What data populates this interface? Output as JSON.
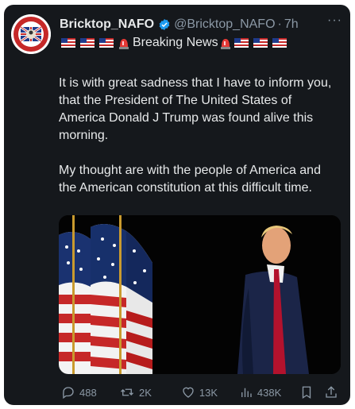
{
  "tweet": {
    "display_name": "Bricktop_NAFO",
    "handle": "@Bricktop_NAFO",
    "separator": "·",
    "time": "7h",
    "more_label": "···",
    "bio_text": "Breaking News",
    "paragraph1": "It is with great sadness that I have to inform you, that the President of The United States of America Donald J Trump was found alive this morning.",
    "paragraph2": "My thought are with the people of America and the American constitution at this difficult time."
  },
  "metrics": {
    "replies": "488",
    "reposts": "2K",
    "likes": "13K",
    "views": "438K"
  },
  "colors": {
    "background": "#15181c",
    "text": "#e7e9ea",
    "muted": "#8b98a5",
    "verified": "#1d9bf0"
  },
  "icons": [
    "verified-badge-icon",
    "us-flag-icon",
    "siren-icon",
    "reply-icon",
    "repost-icon",
    "like-icon",
    "views-icon",
    "bookmark-icon",
    "share-icon"
  ]
}
